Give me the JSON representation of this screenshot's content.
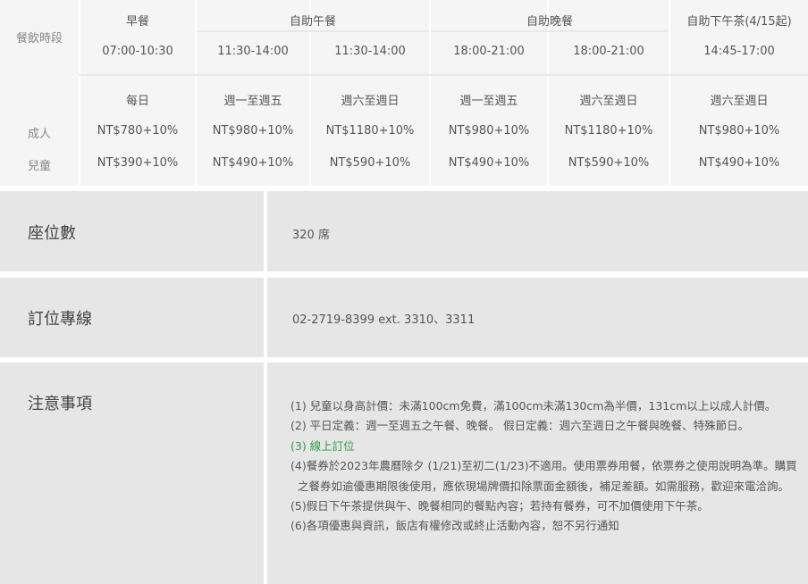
{
  "price_table": {
    "label_col": {
      "meal_period": "餐飲時段",
      "adult": "成人",
      "child": "兒童"
    },
    "groups": [
      {
        "name": "早餐"
      },
      {
        "name": "自助午餐"
      },
      {
        "name": "自助晚餐"
      },
      {
        "name": "自助下午茶(4/15起)"
      }
    ],
    "columns": [
      {
        "time": "07:00-10:30",
        "days": "每日",
        "adult": "NT$780+10%",
        "child": "NT$390+10%"
      },
      {
        "time": "11:30-14:00",
        "days": "週一至週五",
        "adult": "NT$980+10%",
        "child": "NT$490+10%"
      },
      {
        "time": "11:30-14:00",
        "days": "週六至週日",
        "adult": "NT$1180+10%",
        "child": "NT$590+10%"
      },
      {
        "time": "18:00-21:00",
        "days": "週一至週五",
        "adult": "NT$980+10%",
        "child": "NT$490+10%"
      },
      {
        "time": "18:00-21:00",
        "days": "週六至週日",
        "adult": "NT$1180+10%",
        "child": "NT$590+10%"
      },
      {
        "time": "14:45-17:00",
        "days": "週六至週日",
        "adult": "NT$980+10%",
        "child": "NT$490+10%"
      }
    ]
  },
  "info": {
    "seats": {
      "title": "座位數",
      "value": "320 席"
    },
    "phone": {
      "title": "訂位專線",
      "value": "02-2719-8399 ext. 3310、3311"
    },
    "notes": {
      "title": "注意事項",
      "items": [
        "(1) 兒童以身高計價：未滿100cm免費，滿100cm未滿130cm為半價，131cm以上以成人計價。",
        "(2) 平日定義：週一至週五之午餐、晚餐。 假日定義：週六至週日之午餐與晚餐、特殊節日。",
        "(3) 線上訂位",
        "(4)餐券於2023年農曆除夕 (1/21)至初二(1/23)不適用。使用票券用餐，依票券之使用說明為準。購買之餐券如逾優惠期限後使用，應依現場牌價扣除票面金額後，補足差額。如需服務，歡迎來電洽詢。",
        "(5)假日下午茶提供與午、晚餐相同的餐點內容；若持有餐券，可不加價使用下午茶。",
        "(6)各項優惠與資訊，飯店有權修改或終止活動內容，恕不另行通知"
      ],
      "link_color": "#2e9e4f"
    }
  }
}
